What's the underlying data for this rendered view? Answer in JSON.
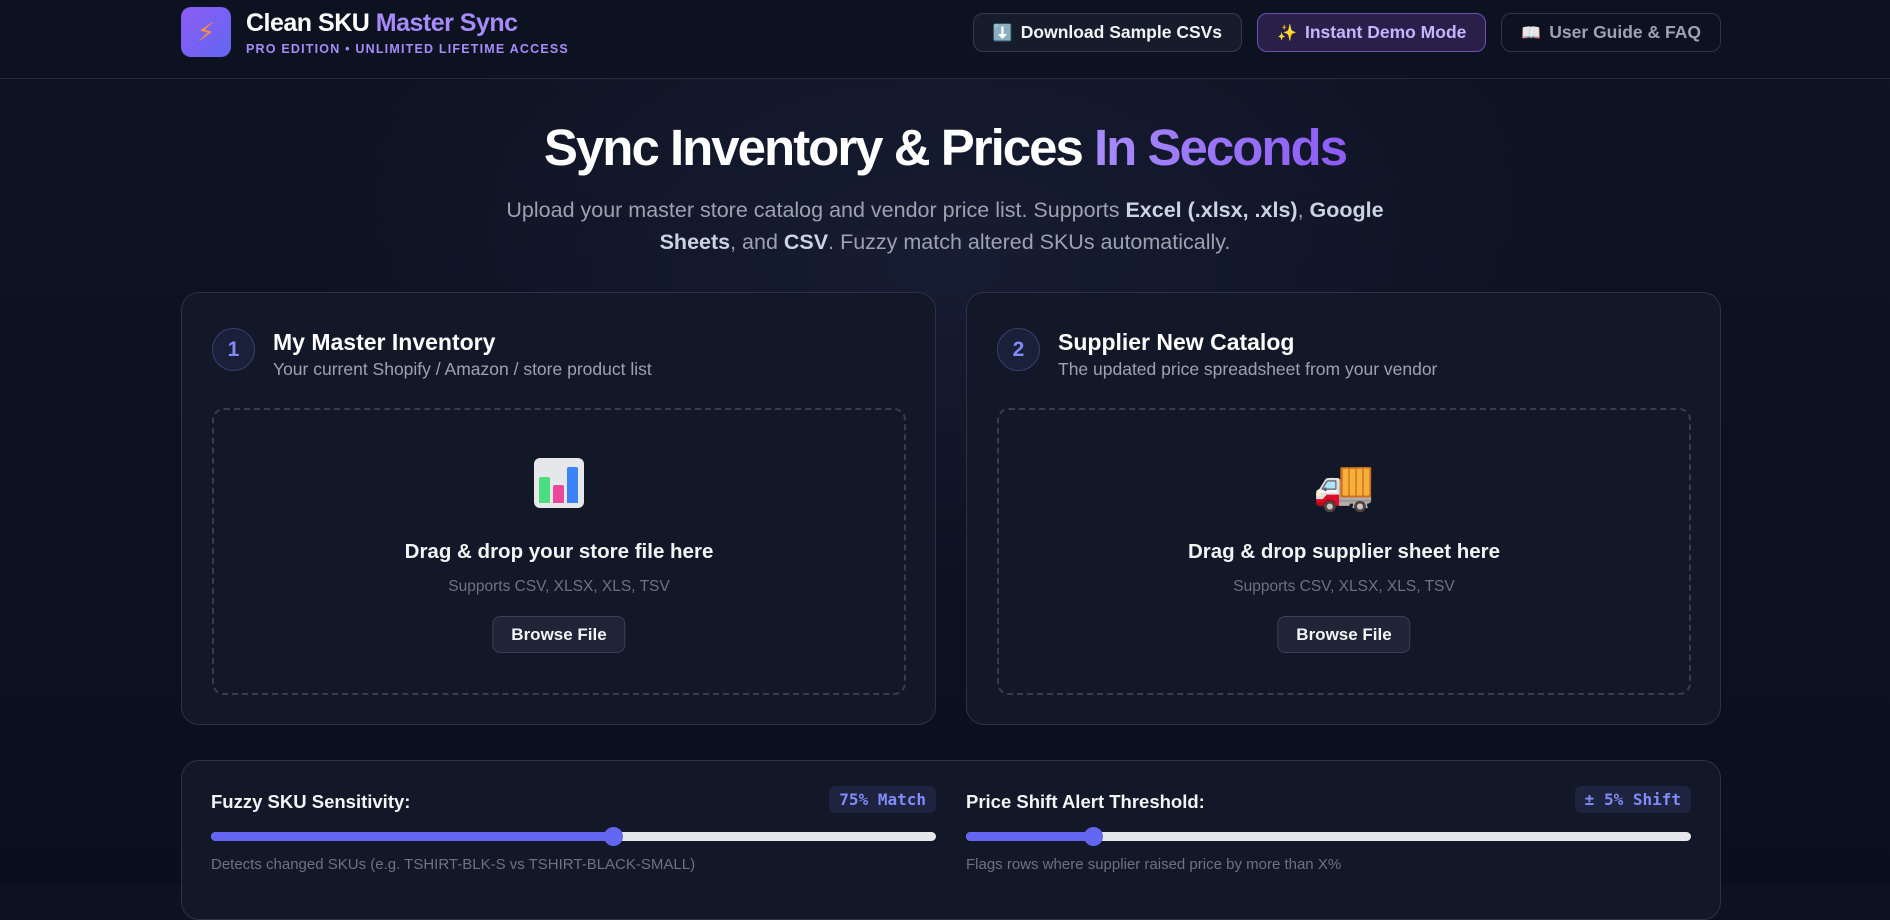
{
  "header": {
    "logo_icon": "lightning-bolt-icon",
    "title_main": "Clean SKU",
    "title_accent": "Master Sync",
    "subtitle": "PRO EDITION • UNLIMITED LIFETIME ACCESS",
    "buttons": [
      {
        "icon": "⬇️",
        "icon_name": "download-icon",
        "label": "Download Sample CSVs"
      },
      {
        "icon": "✨",
        "icon_name": "sparkles-icon",
        "label": "Instant Demo Mode"
      },
      {
        "icon": "📖",
        "icon_name": "book-icon",
        "label": "User Guide & FAQ"
      }
    ]
  },
  "hero": {
    "title_main": "Sync Inventory & Prices",
    "title_accent": "In Seconds",
    "subtitle_parts": {
      "p1": "Upload your master store catalog and vendor price list. Supports ",
      "b1": "Excel (.xlsx, .xls)",
      "p2": ", ",
      "b2": "Google Sheets",
      "p3": ", and ",
      "b3": "CSV",
      "p4": ". Fuzzy match altered SKUs automatically."
    }
  },
  "cards": [
    {
      "step": "1",
      "title": "My Master Inventory",
      "description": "Your current Shopify / Amazon / store product list",
      "icon_name": "bar-chart-icon",
      "drop_title": "Drag & drop your store file here",
      "drop_sub": "Supports CSV, XLSX, XLS, TSV",
      "browse_label": "Browse File"
    },
    {
      "step": "2",
      "title": "Supplier New Catalog",
      "description": "The updated price spreadsheet from your vendor",
      "icon": "🚚",
      "icon_name": "delivery-truck-icon",
      "drop_title": "Drag & drop supplier sheet here",
      "drop_sub": "Supports CSV, XLSX, XLS, TSV",
      "browse_label": "Browse File"
    }
  ],
  "settings": {
    "sensitivity": {
      "label": "Fuzzy SKU Sensitivity:",
      "badge": "75% Match",
      "value_fraction": 0.555,
      "help": "Detects changed SKUs (e.g. TSHIRT-BLK-S vs TSHIRT-BLACK-SMALL)"
    },
    "threshold": {
      "label": "Price Shift Alert Threshold:",
      "badge": "± 5% Shift",
      "value_fraction": 0.175,
      "help": "Flags rows where supplier raised price by more than X%"
    }
  },
  "colors": {
    "accent": "#a78bfa",
    "primary": "#6366f1",
    "background": "#0d1222"
  }
}
